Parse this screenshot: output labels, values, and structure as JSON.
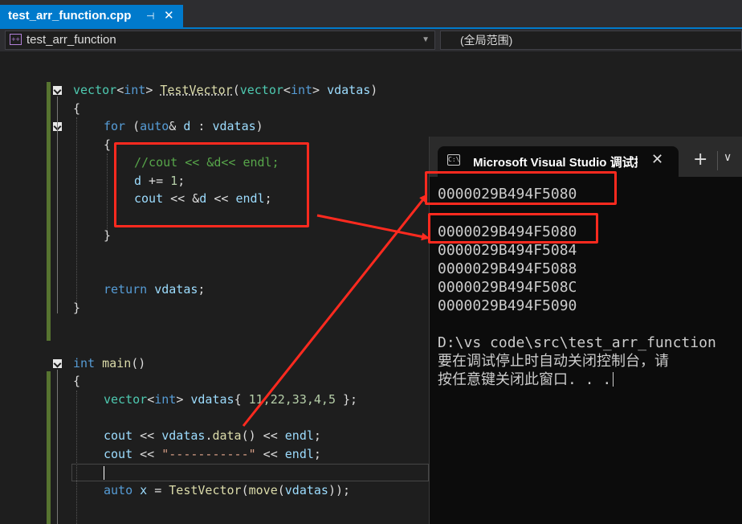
{
  "tab": {
    "filename": "test_arr_function.cpp",
    "pin": "⊣",
    "close": "✕"
  },
  "navbar": {
    "project": "test_arr_function",
    "scope": "(全局范围)"
  },
  "code": {
    "l1": {
      "t1": "vector",
      "t2": "<",
      "t3": "int",
      "t4": "> ",
      "t5": "TestVector",
      "t6": "(",
      "t7": "vector",
      "t8": "<",
      "t9": "int",
      "t10": "> ",
      "t11": "vdatas",
      "t12": ")"
    },
    "l2": "{",
    "l3": {
      "t1": "for",
      "t2": " (",
      "t3": "auto",
      "t4": "& ",
      "t5": "d",
      "t6": " : ",
      "t7": "vdatas",
      "t8": ")"
    },
    "l4": "{",
    "l5": "//cout << &d<< endl;",
    "l6": {
      "t1": "d",
      "t2": " += ",
      "t3": "1",
      "t4": ";"
    },
    "l7": {
      "t1": "cout",
      "t2": " << &",
      "t3": "d",
      "t4": " << ",
      "t5": "endl",
      "t6": ";"
    },
    "l8": "}",
    "l9": {
      "t1": "return",
      "t2": " ",
      "t3": "vdatas",
      "t4": ";"
    },
    "l10": "}",
    "l11": {
      "t1": "int",
      "t2": " ",
      "t3": "main",
      "t4": "()"
    },
    "l12": "{",
    "l13": {
      "t1": "vector",
      "t2": "<",
      "t3": "int",
      "t4": "> ",
      "t5": "vdatas",
      "t6": "{ ",
      "t7": "11,22,33,4,5",
      "t8": " };"
    },
    "l14": {
      "t1": "cout",
      "t2": " << ",
      "t3": "vdatas",
      "t4": ".",
      "t5": "data",
      "t6": "() << ",
      "t7": "endl",
      "t8": ";"
    },
    "l15": {
      "t1": "cout",
      "t2": " << ",
      "t3": "\"-----------\"",
      "t4": " << ",
      "t5": "endl",
      "t6": ";"
    },
    "l16": {
      "t1": "auto",
      "t2": " ",
      "t3": "x",
      "t4": " = ",
      "t5": "TestVector",
      "t6": "(",
      "t7": "move",
      "t8": "(",
      "t9": "vdatas",
      "t10": "));"
    }
  },
  "console": {
    "title": "Microsoft Visual Studio 调试控制台",
    "close": "✕",
    "plus": "+",
    "chevron": "∨",
    "lines": [
      "0000029B494F5080",
      "0000029B494F5080",
      "0000029B494F5084",
      "0000029B494F5088",
      "0000029B494F508C",
      "0000029B494F5090",
      "D:\\vs code\\src\\test_arr_function",
      "要在调试停止时自动关闭控制台，请",
      "按任意键关闭此窗口. . ."
    ]
  },
  "colors": {
    "annotation": "#ff2a1f",
    "accent": "#007acc",
    "change_bar": "#577430"
  }
}
